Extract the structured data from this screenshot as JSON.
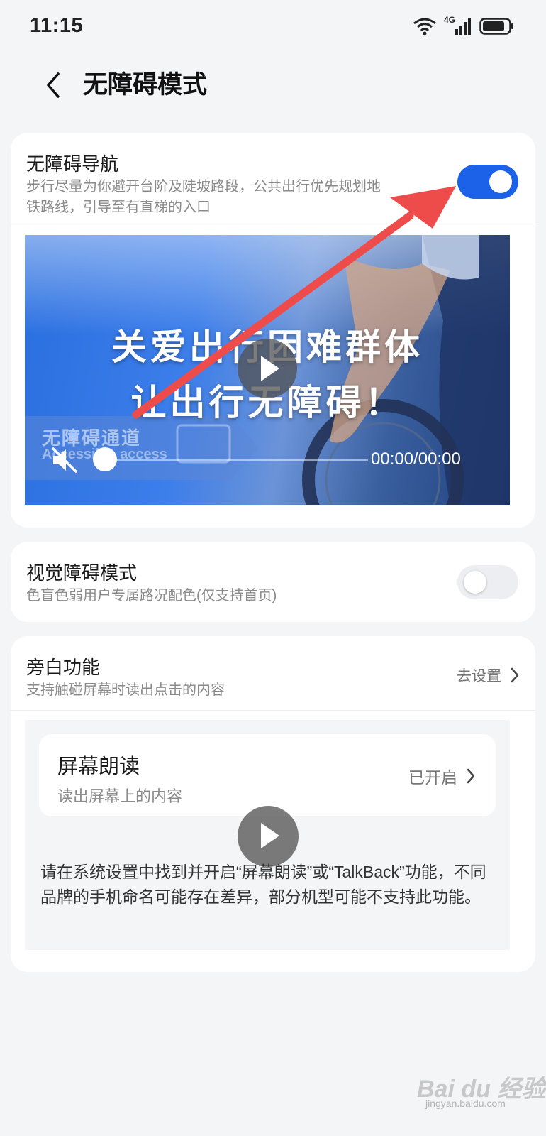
{
  "status_bar": {
    "time": "11:15",
    "network": "4G"
  },
  "header": {
    "title": "无障碍模式"
  },
  "nav_card": {
    "title": "无障碍导航",
    "subtitle_line1": "步行尽量为你避开台阶及陡坡路段，公共出行优先规划地",
    "subtitle_line2": "铁路线，引导至有直梯的入口",
    "toggle_on": true,
    "video": {
      "headline1": "关爱出行困难群体",
      "headline2": "让出行无障碍！",
      "sign_cn": "无障碍通道",
      "sign_en": "Accessible access",
      "time": "00:00/00:00"
    }
  },
  "visual_card": {
    "title": "视觉障碍模式",
    "subtitle": "色盲色弱用户专属路况配色(仅支持首页)",
    "toggle_on": false
  },
  "narration_card": {
    "title": "旁白功能",
    "subtitle": "支持触碰屏幕时读出点击的内容",
    "action": "去设置",
    "screen_reader": {
      "title": "屏幕朗读",
      "subtitle": "读出屏幕上的内容",
      "status": "已开启"
    },
    "note": "请在系统设置中找到并开启“屏幕朗读”或“TalkBack”功能，不同品牌的手机命名可能存在差异，部分机型可能不支持此功能。"
  },
  "watermark": {
    "brand": "Bai du 经验",
    "url": "jingyan.baidu.com"
  },
  "colors": {
    "accent": "#1c62e8",
    "arrow": "#ee4b4b"
  }
}
